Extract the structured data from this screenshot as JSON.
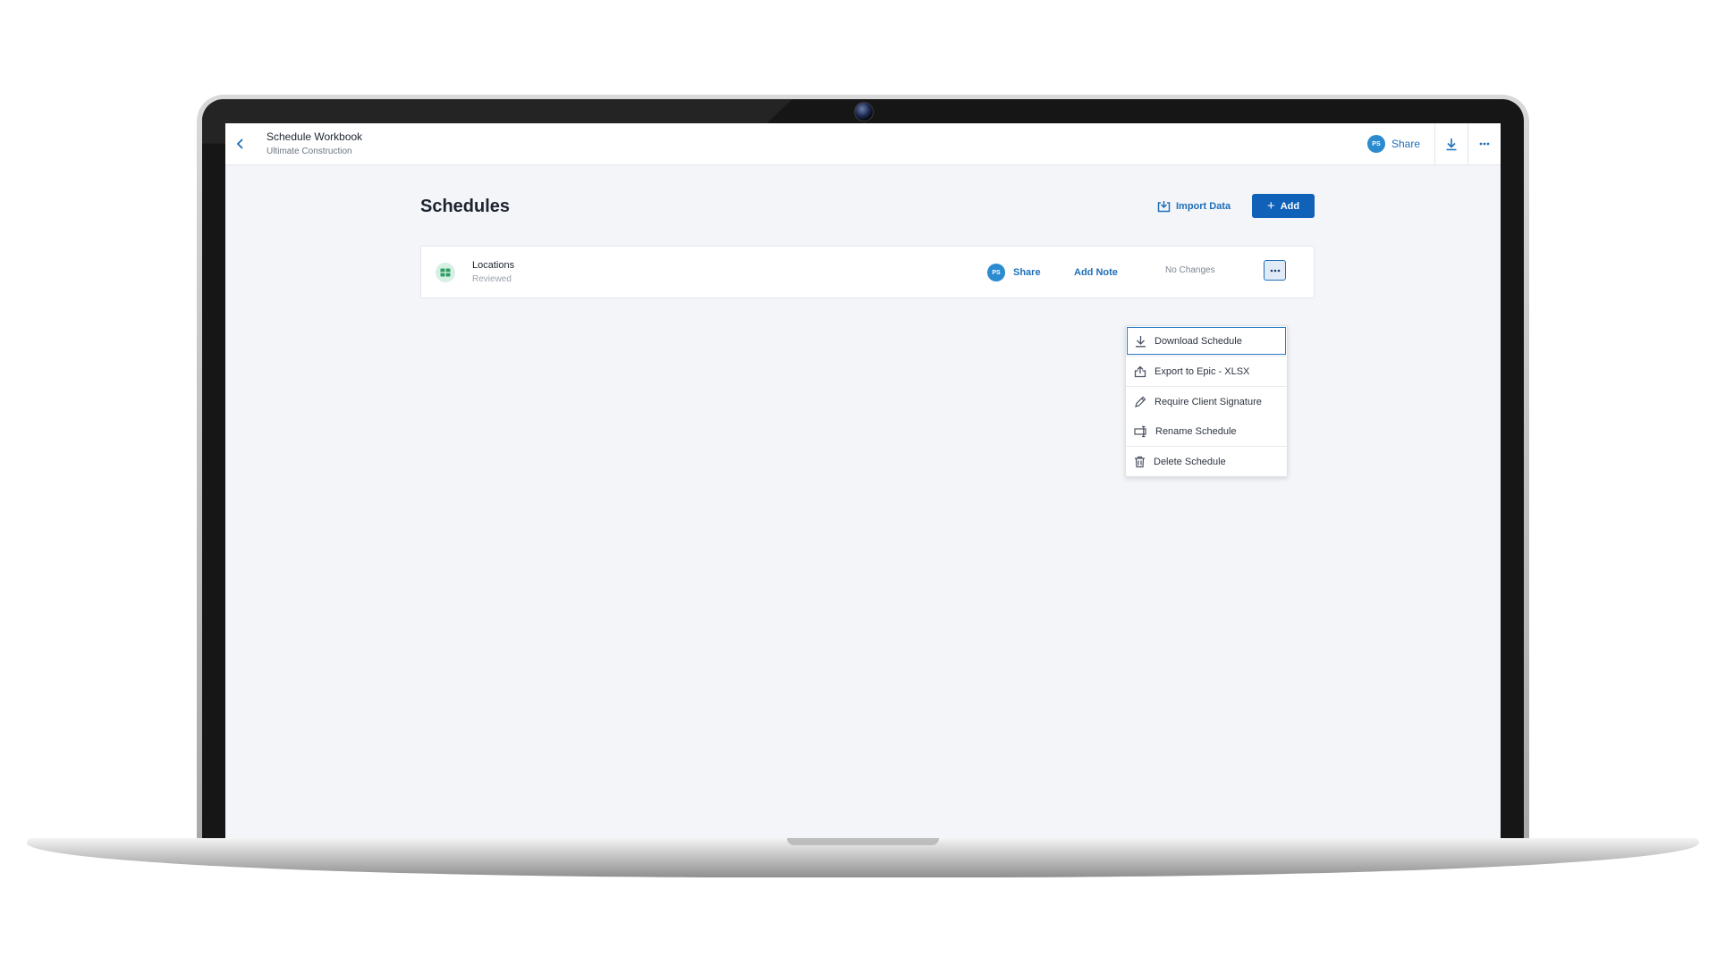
{
  "header": {
    "title": "Schedule Workbook",
    "subtitle": "Ultimate Construction",
    "avatar_initials": "PS",
    "share_label": "Share"
  },
  "page": {
    "title": "Schedules",
    "import_label": "Import Data",
    "add_label": "Add"
  },
  "schedule": {
    "name": "Locations",
    "status": "Reviewed",
    "avatar_initials": "PS",
    "share_label": "Share",
    "add_note_label": "Add Note",
    "changes_label": "No Changes"
  },
  "menu": {
    "items": [
      {
        "label": "Download Schedule",
        "icon": "download-icon"
      },
      {
        "label": "Export to Epic - XLSX",
        "icon": "export-icon"
      },
      {
        "label": "Require Client Signature",
        "icon": "pen-icon"
      },
      {
        "label": "Rename Schedule",
        "icon": "rename-icon"
      },
      {
        "label": "Delete Schedule",
        "icon": "trash-icon"
      }
    ]
  },
  "colors": {
    "accent": "#1061b8",
    "link": "#1f6fb8",
    "avatar": "#2a8bd0",
    "sheet_icon": "#2e9e64"
  }
}
